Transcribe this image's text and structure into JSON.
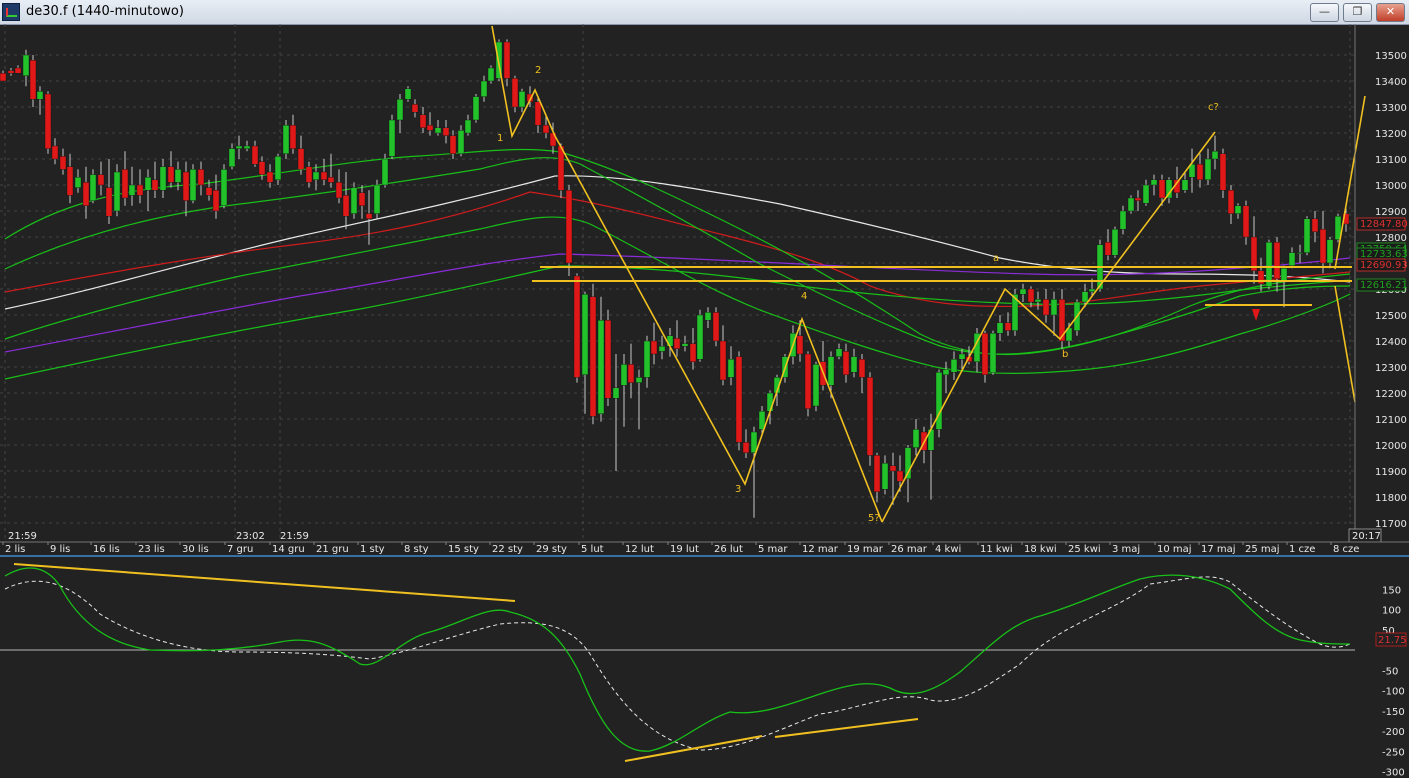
{
  "window": {
    "title": "de30.f (1440-minutowo)",
    "buttons": {
      "minimize": "—",
      "restore": "❐",
      "close": "✕"
    }
  },
  "price_axis": {
    "ticks": [
      "13500",
      "13400",
      "13300",
      "13200",
      "13100",
      "13000",
      "12900",
      "12800",
      "12700",
      "12600",
      "12500",
      "12400",
      "12300",
      "12200",
      "12100",
      "12000",
      "11900",
      "11800",
      "11700"
    ],
    "tags": [
      {
        "label": "12847.80",
        "color": "#e03030"
      },
      {
        "label": "12750.64",
        "color": "#20a020"
      },
      {
        "label": "12733.63",
        "color": "#20a020"
      },
      {
        "label": "12690.93",
        "color": "#e03030"
      },
      {
        "label": "12616.21",
        "color": "#20a020"
      }
    ],
    "time_readout": "20:17"
  },
  "time_axis": {
    "time_marks": [
      "21:59",
      "23:02",
      "21:59"
    ],
    "labels": [
      "2 lis",
      "9 lis",
      "16 lis",
      "23 lis",
      "30 lis",
      "7 gru",
      "14 gru",
      "21 gru",
      "1 sty",
      "8 sty",
      "15 sty",
      "22 sty",
      "29 sty",
      "5 lut",
      "12 lut",
      "19 lut",
      "26 lut",
      "5 mar",
      "12 mar",
      "19 mar",
      "26 mar",
      "4 kwi",
      "11 kwi",
      "18 kwi",
      "25 kwi",
      "3 maj",
      "10 maj",
      "17 maj",
      "25 maj",
      "1 cze",
      "8 cze"
    ]
  },
  "wave_labels": [
    "1",
    "2",
    "3",
    "4",
    "5?",
    "a",
    "b",
    "c?"
  ],
  "oscillator": {
    "ticks": [
      "150",
      "100",
      "50",
      "-50",
      "-100",
      "-150",
      "-200",
      "-250",
      "-300"
    ],
    "value_tag": "21.75"
  },
  "colors": {
    "background": "#222222",
    "bull_candle": "#22c22a",
    "bear_candle": "#e01818",
    "annotation": "#f0c020",
    "grid": "#5a5a5a"
  }
}
